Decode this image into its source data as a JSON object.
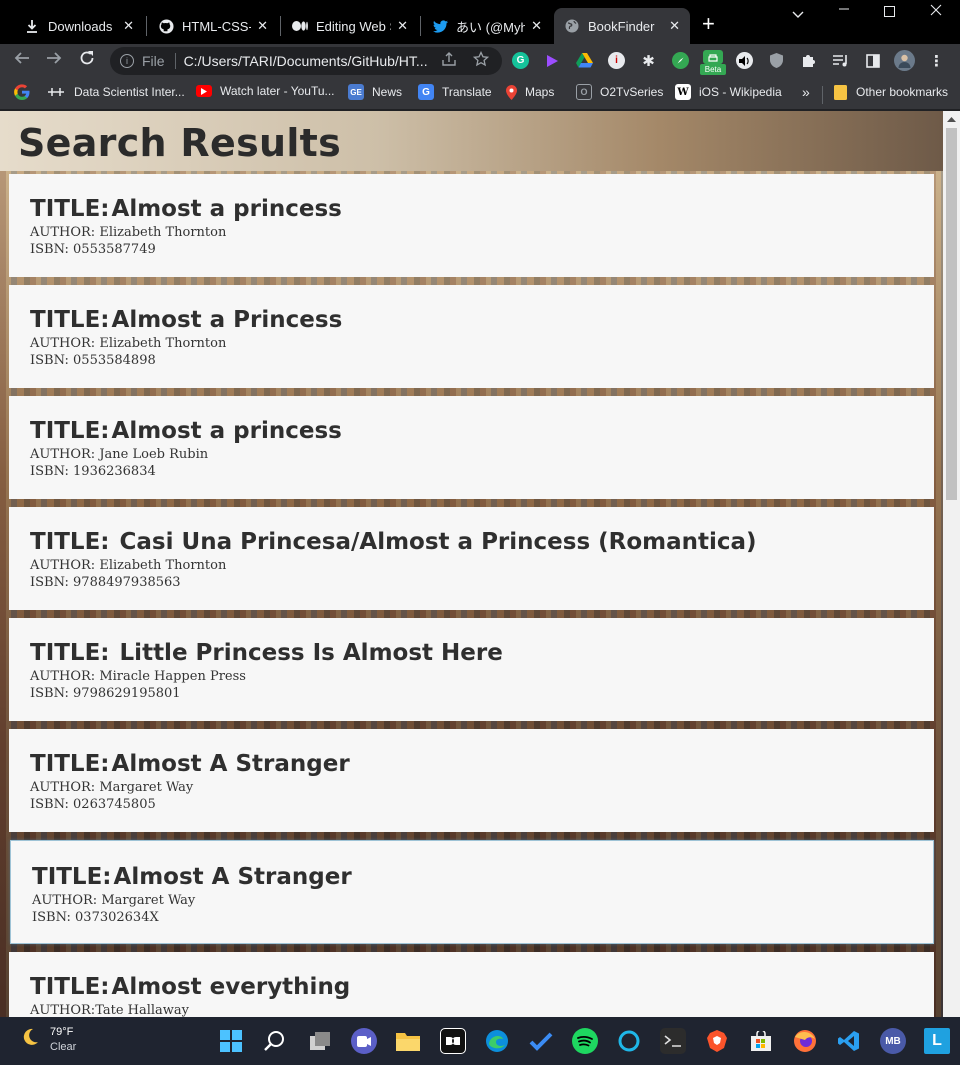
{
  "browser": {
    "tabs": [
      {
        "title": "Downloads",
        "icon": "download-icon"
      },
      {
        "title": "HTML-CSS-JA",
        "icon": "github-icon"
      },
      {
        "title": "Editing Web S",
        "icon": "medium-icon"
      },
      {
        "title": "あい (@MyhnT",
        "icon": "twitter-icon"
      },
      {
        "title": "BookFinder",
        "icon": "globe-icon",
        "active": true
      }
    ],
    "address": {
      "prefix": "File",
      "url": "C:/Users/TARI/Documents/GitHub/HT..."
    },
    "bookmarks": [
      {
        "label": "",
        "icon": "google-icon"
      },
      {
        "label": "Data Scientist Inter...",
        "icon": "bookmark-icon"
      },
      {
        "label": "Watch later - YouTu...",
        "icon": "youtube-icon"
      },
      {
        "label": "News",
        "icon": "news-icon"
      },
      {
        "label": "Translate",
        "icon": "translate-icon"
      },
      {
        "label": "Maps",
        "icon": "maps-icon"
      },
      {
        "label": "O2TvSeries",
        "icon": "o2tv-icon"
      },
      {
        "label": "iOS - Wikipedia",
        "icon": "wikipedia-icon"
      }
    ],
    "more_bookmarks": "»",
    "other_bookmarks": "Other bookmarks",
    "beta_badge": "Beta"
  },
  "page": {
    "title": "Search Results",
    "title_prefix": "TITLE:",
    "author_prefix": "AUTHOR:",
    "isbn_prefix": "ISBN:",
    "results": [
      {
        "title": "Almost a princess",
        "author": "Elizabeth Thornton",
        "isbn": "0553587749"
      },
      {
        "title": "Almost a Princess",
        "author": "Elizabeth Thornton",
        "isbn": "0553584898"
      },
      {
        "title": "Almost a princess",
        "author": "Jane Loeb Rubin",
        "isbn": "1936236834"
      },
      {
        "title": "Casi Una Princesa/Almost a Princess (Romantica)",
        "author": "Elizabeth Thornton",
        "isbn": "9788497938563"
      },
      {
        "title": "Little Princess Is Almost Here",
        "author": "Miracle Happen Press",
        "isbn": "9798629195801"
      },
      {
        "title": "Almost A Stranger",
        "author": "Margaret Way",
        "isbn": "0263745805"
      },
      {
        "title": "Almost A Stranger",
        "author": "Margaret Way",
        "isbn": "037302634X"
      },
      {
        "title": "Almost everything",
        "author": "Tate Hallaway",
        "isbn": ""
      }
    ]
  },
  "taskbar": {
    "weather": {
      "temp": "79°F",
      "condition": "Clear"
    }
  }
}
